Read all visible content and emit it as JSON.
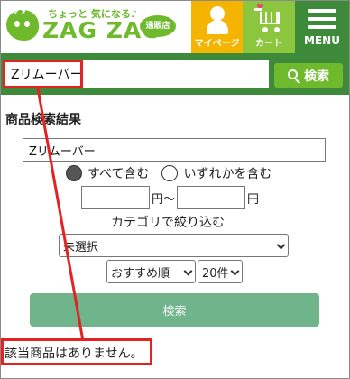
{
  "header": {
    "logo_tagline": "ちょっと 気になる♪",
    "logo_word": "ZAG ZAG",
    "logo_badge": "通販店",
    "logo_mark": "z z",
    "mypage_label": "マイページ",
    "cart_label": "カート",
    "menu_label": "MENU",
    "colors": {
      "brand_green": "#6fb92c",
      "dark_green": "#3c8a3a",
      "mypage_yellow": "#f5b400",
      "cart_green": "#8cc63f"
    }
  },
  "searchbar": {
    "query": "Zリムーバー",
    "button_label": "検索",
    "icon": "search-icon"
  },
  "results": {
    "section_title": "商品検索結果",
    "keyword_value": "Zリムーバー",
    "match_all_label": "すべて含む",
    "match_any_label": "いずれかを含む",
    "match_selected": "all",
    "price_unit_from": "円〜",
    "price_unit_to": "円",
    "price_min": "",
    "price_max": "",
    "category_label": "カテゴリで絞り込む",
    "category_selected": "未選択",
    "sort_selected": "おすすめ順",
    "count_selected": "20件",
    "submit_label": "検索",
    "no_results_message": "該当商品はありません。"
  },
  "annotations": {
    "color": "#e32322"
  }
}
